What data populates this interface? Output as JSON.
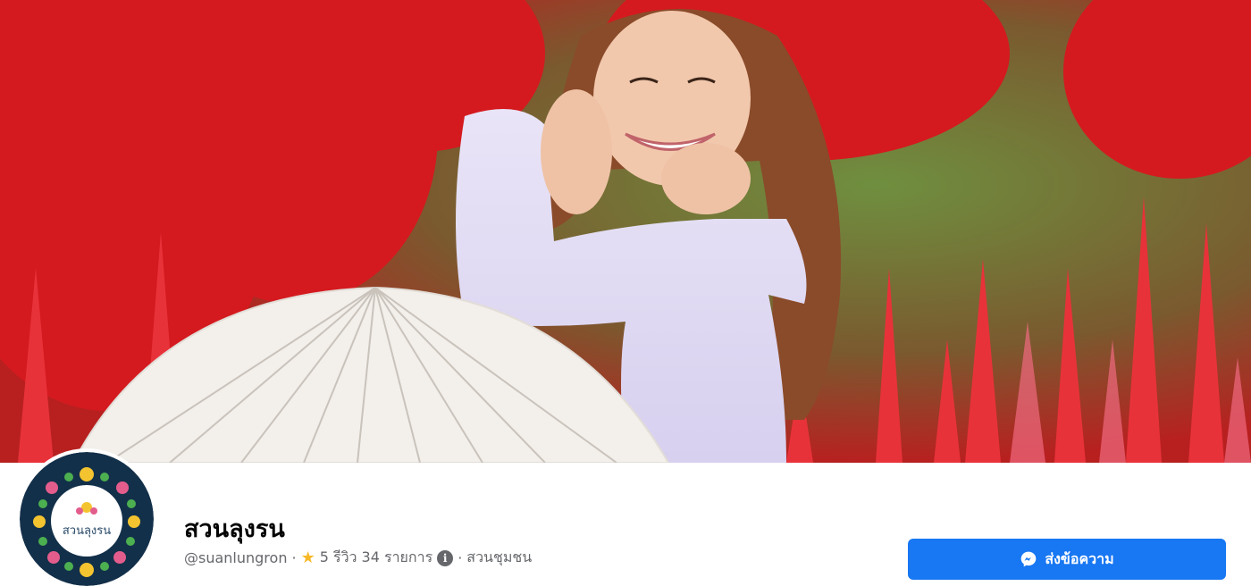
{
  "page": {
    "name": "สวนลุงรน",
    "handle": "@suanlungron",
    "rating_text": "5 รีวิว",
    "reviews_count": "34 รายการ",
    "category": "สวนชุมชน",
    "separator": "·"
  },
  "avatar": {
    "text": "สวนลุงรน"
  },
  "actions": {
    "message_label": "ส่งข้อความ"
  },
  "icons": {
    "rating": "star-icon",
    "info": "info-icon",
    "message": "messenger-icon"
  },
  "colors": {
    "primary_button": "#1877f2",
    "secondary_text": "#65676b",
    "star": "#f7b928"
  }
}
